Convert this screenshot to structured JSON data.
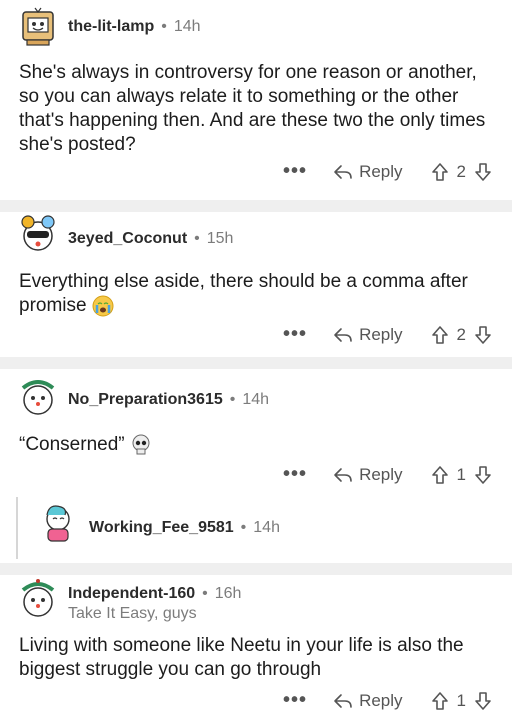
{
  "comments": [
    {
      "username": "the-lit-lamp",
      "time": "14h",
      "body": "She's always in controversy for one reason or another, so you can always relate it to something or the other that's happening then. And are these two the only times she's posted?",
      "reply_label": "Reply",
      "votes": "2"
    },
    {
      "username": "3eyed_Coconut",
      "time": "15h",
      "body": "Everything else aside, there should be a comma after promise",
      "reply_label": "Reply",
      "votes": "2"
    },
    {
      "username": "No_Preparation3615",
      "time": "14h",
      "body": "“Conserned”",
      "reply_label": "Reply",
      "votes": "1"
    },
    {
      "username": "Working_Fee_9581",
      "time": "14h"
    },
    {
      "username": "Independent-160",
      "time": "16h",
      "flair": "Take It Easy, guys",
      "body": "Living with someone like Neetu in your life is also the biggest struggle you can go through",
      "reply_label": "Reply",
      "votes": "1"
    }
  ],
  "more_label": "•••",
  "separator_dot": "•",
  "colors": {
    "separator": "#efefef",
    "meta": "#7c7c7c",
    "text": "#1c1c1c"
  }
}
